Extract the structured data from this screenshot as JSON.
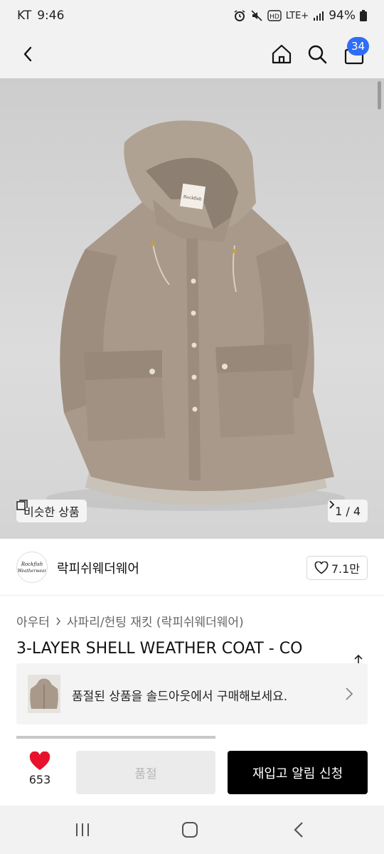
{
  "status_bar": {
    "carrier": "KT",
    "time": "9:46",
    "network": "LTE+",
    "battery": "94%"
  },
  "header": {
    "cart_count": "34",
    "icons": [
      "back-icon",
      "home-icon",
      "search-icon",
      "shopping-bag-icon"
    ]
  },
  "gallery": {
    "similar_label": "비슷한 상품",
    "page_indicator": "1 / 4",
    "logo_text": "Rockfish Weatherwear"
  },
  "brand": {
    "name": "락피쉬웨더웨어",
    "logo_text": "Rockfish Weatherwear",
    "likes": "7.1만"
  },
  "breadcrumb": {
    "category": "아우터",
    "subcategory": "사파리/헌팅 재킷 (락피쉬웨더웨어)"
  },
  "product": {
    "title": "3-LAYER SHELL WEATHER COAT - CO"
  },
  "soldout_banner": {
    "text": "품절된 상품을 솔드아웃에서 구매해보세요."
  },
  "bottom_bar": {
    "wish_count": "653",
    "soldout_label": "품절",
    "restock_label": "재입고 알림 신청"
  },
  "colors": {
    "accent": "#2f6df6",
    "heart": "#e8112d",
    "cta": "#000000",
    "coat": "#a8998a"
  }
}
